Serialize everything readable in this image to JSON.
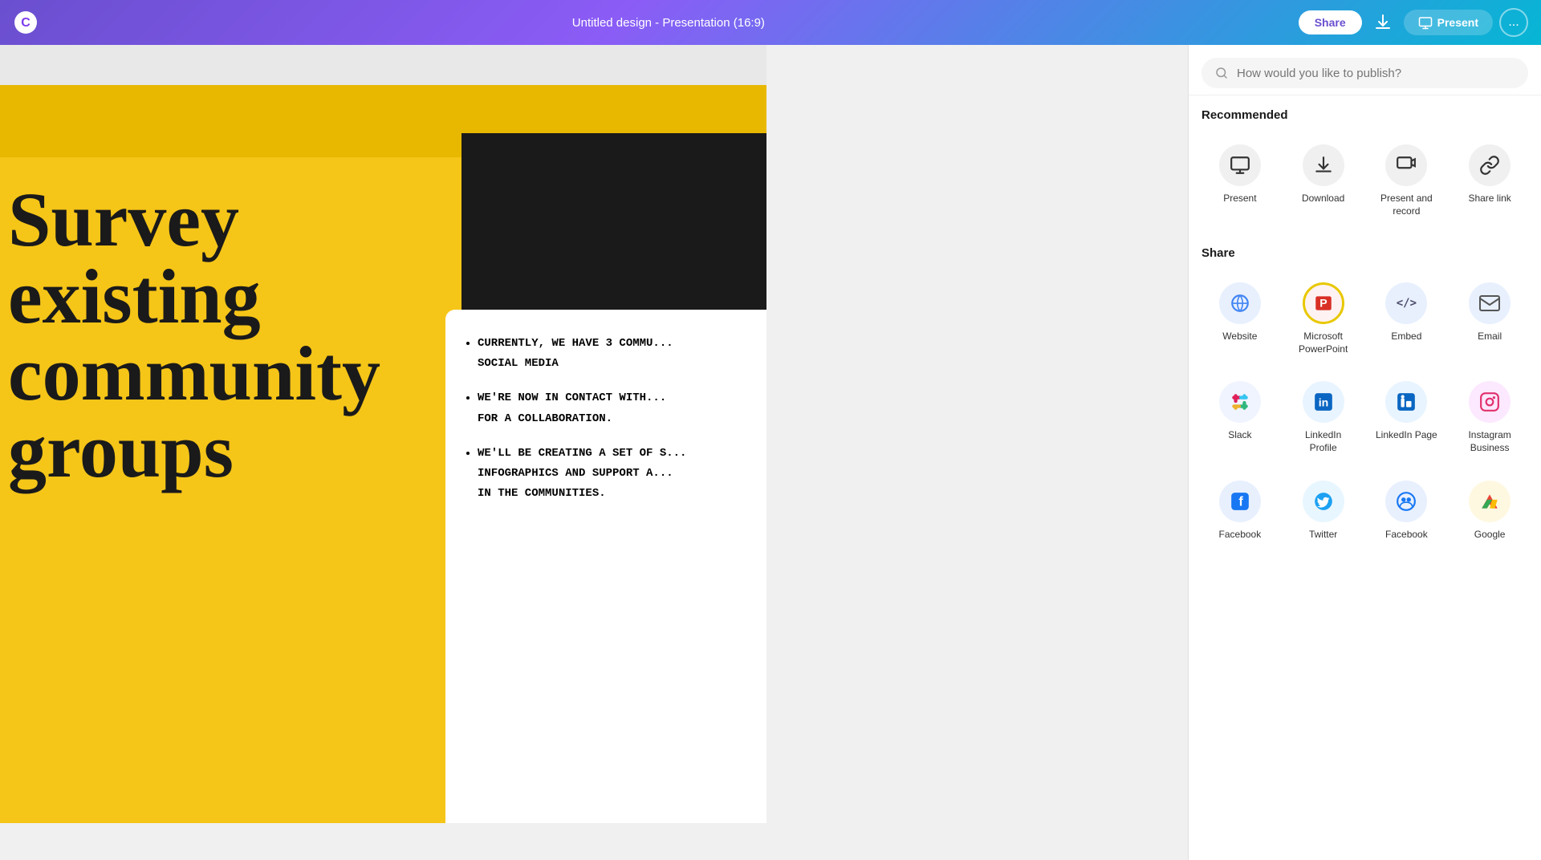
{
  "header": {
    "title": "Untitled design - Presentation (16:9)",
    "share_label": "Share",
    "download_label": "",
    "present_label": "Present",
    "more_label": "..."
  },
  "search": {
    "placeholder": "How would you like to publish?"
  },
  "recommended": {
    "section_title": "Recommended",
    "items": [
      {
        "id": "present",
        "label": "Present",
        "icon": "🖥"
      },
      {
        "id": "download",
        "label": "Download",
        "icon": "⬇"
      },
      {
        "id": "present-record",
        "label": "Present and record",
        "icon": "📹"
      },
      {
        "id": "share-link",
        "label": "Share link",
        "icon": "🔗"
      }
    ]
  },
  "share": {
    "section_title": "Share",
    "items": [
      {
        "id": "website",
        "label": "Website",
        "icon": "🌐",
        "color_class": "ic-website"
      },
      {
        "id": "powerpoint",
        "label": "Microsoft PowerPoint",
        "icon": "P",
        "color_class": "ic-powerpoint",
        "highlighted": true
      },
      {
        "id": "embed",
        "label": "Embed",
        "icon": "</>",
        "color_class": "ic-embed"
      },
      {
        "id": "email",
        "label": "Email",
        "icon": "✉",
        "color_class": "ic-email"
      },
      {
        "id": "slack",
        "label": "Slack",
        "icon": "#",
        "color_class": "ic-slack"
      },
      {
        "id": "linkedin-profile",
        "label": "LinkedIn Profile",
        "icon": "in",
        "color_class": "ic-linkedin"
      },
      {
        "id": "linkedin-page",
        "label": "LinkedIn Page",
        "icon": "in",
        "color_class": "ic-linkedin-page"
      },
      {
        "id": "instagram-business",
        "label": "Instagram Business",
        "icon": "📷",
        "color_class": "ic-instagram"
      },
      {
        "id": "facebook",
        "label": "Facebook",
        "icon": "f",
        "color_class": "ic-facebook"
      },
      {
        "id": "twitter",
        "label": "Twitter",
        "icon": "🐦",
        "color_class": "ic-twitter"
      },
      {
        "id": "facebook2",
        "label": "Facebook",
        "icon": "👥",
        "color_class": "ic-facebook2"
      },
      {
        "id": "google",
        "label": "Google",
        "icon": "▲",
        "color_class": "ic-google"
      }
    ]
  },
  "slide": {
    "title": "Survey existing community groups",
    "bullets": [
      "CURRENTLY, WE HAVE 3 COMMU... SOCIAL MEDIA",
      "WE'RE NOW IN CONTACT WITH... FOR A COLLABORATION.",
      "WE'LL BE CREATING A SET OF S... INFOGRAPHICS AND SUPPORT A... IN THE COMMUNITIES."
    ]
  }
}
